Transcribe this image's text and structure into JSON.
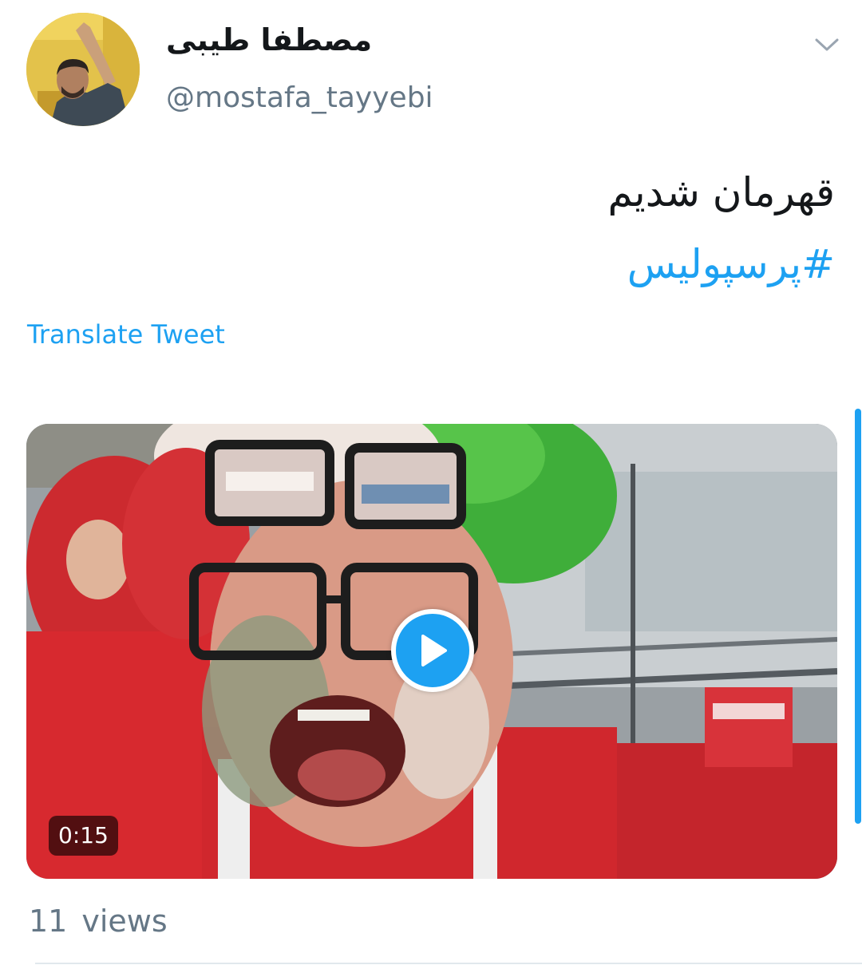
{
  "user": {
    "display_name": "مصطفا طیبی",
    "handle": "@mostafa_tayyebi"
  },
  "tweet": {
    "text": "قهرمان شدیم",
    "hashtag": "#پرسپولیس",
    "translate_label": "Translate Tweet"
  },
  "media": {
    "type": "video",
    "duration": "0:15"
  },
  "stats": {
    "view_count": "11",
    "view_label": "views"
  },
  "colors": {
    "accent": "#1da1f2",
    "muted": "#657786",
    "text": "#14171a"
  },
  "icons": {
    "menu": "chevron-down-icon",
    "play": "play-icon"
  }
}
